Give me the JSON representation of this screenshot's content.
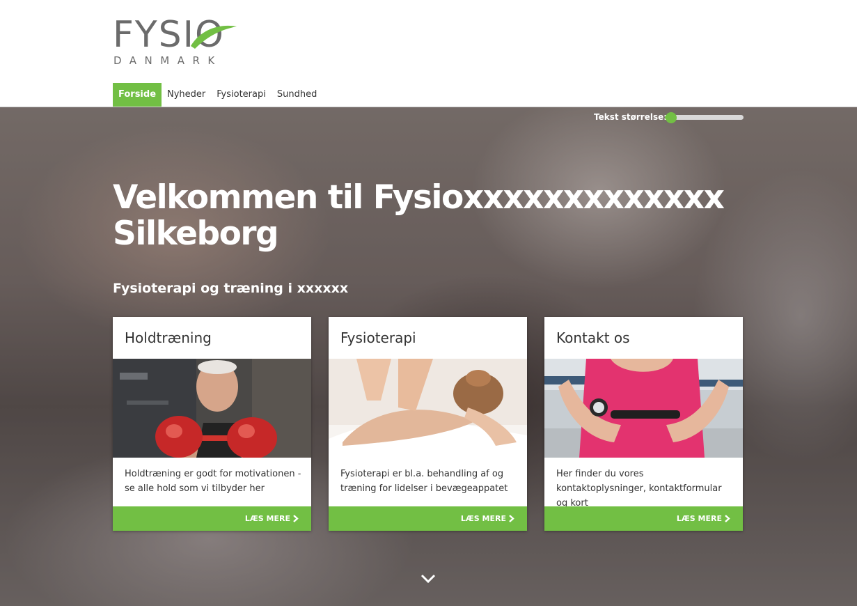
{
  "brand": {
    "logo_word": "FYSIO",
    "logo_sub": "DANMARK",
    "green": "#72bf44",
    "grey": "#6b6b6b"
  },
  "nav": {
    "items": [
      {
        "label": "Forside",
        "active": true
      },
      {
        "label": "Nyheder",
        "active": false
      },
      {
        "label": "Fysioterapi",
        "active": false
      },
      {
        "label": "Sundhed",
        "active": false
      }
    ]
  },
  "text_size": {
    "label": "Tekst størrelse:",
    "level": 0.08
  },
  "hero": {
    "title": "Velkommen til Fysioxxxxxxxxxxxxx Silkeborg",
    "subtitle": "Fysioterapi og træning i xxxxxx"
  },
  "cards": [
    {
      "title": "Holdtræning",
      "text": "Holdtræning er godt for motivationen - se alle hold som vi tilbyder her",
      "button": "LÆS MERE",
      "image": "boxing-senior-photo"
    },
    {
      "title": "Fysioterapi",
      "text": "Fysioterapi er bl.a. behandling af og træning for lidelser i bevægeappatet",
      "button": "LÆS MERE",
      "image": "massage-photo"
    },
    {
      "title": "Kontakt os",
      "text": "Her finder du vores kontaktoplysninger, kontaktformular og kort",
      "button": "LÆS MERE",
      "image": "heart-rate-monitor-photo"
    }
  ],
  "icons": {
    "button_arrow": "chevron-right-icon",
    "scroll_down": "chevron-down-icon"
  }
}
